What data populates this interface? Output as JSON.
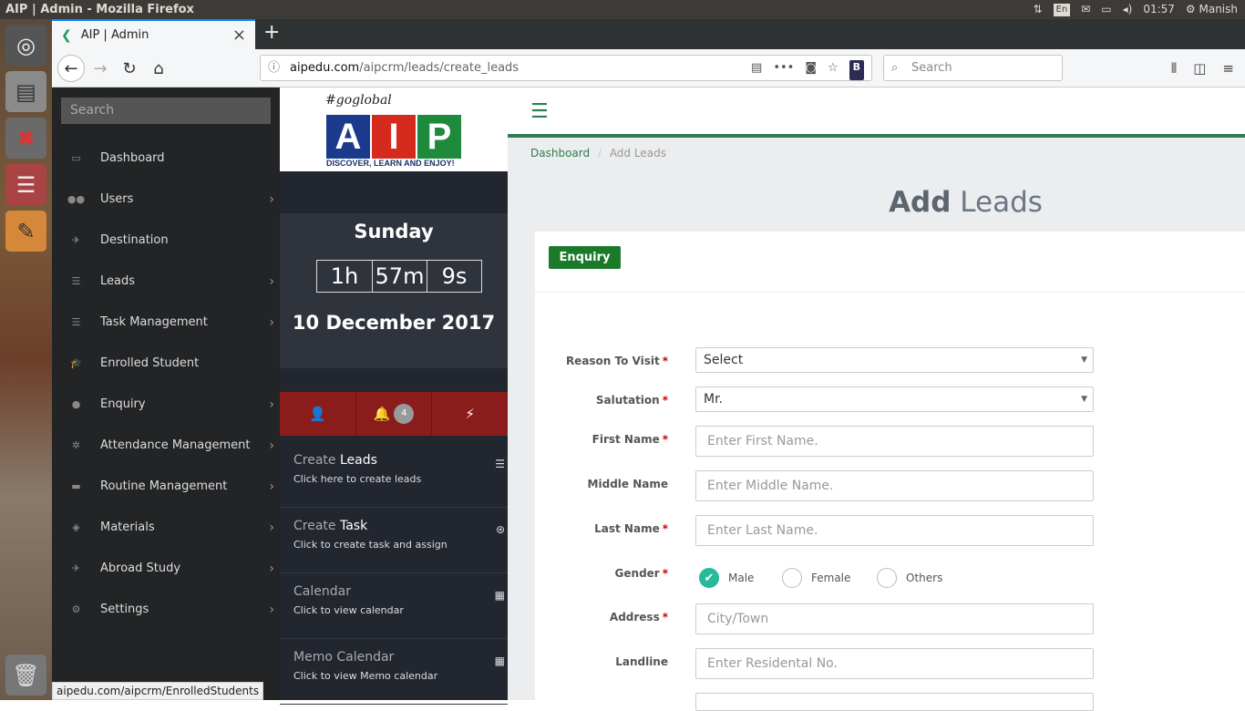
{
  "os": {
    "window_title": "AIP | Admin - Mozilla Firefox",
    "lang": "En",
    "time": "01:57",
    "user": "Manish"
  },
  "browser": {
    "tab_title": "AIP | Admin",
    "url_host": "aipedu.com",
    "url_path": "/aipcrm/leads/create_leads",
    "search_placeholder": "Search",
    "status_url": "aipedu.com/aipcrm/EnrolledStudents"
  },
  "sidebar": {
    "search_placeholder": "Search",
    "items": [
      {
        "label": "Dashboard",
        "icon": "laptop-icon",
        "chev": false
      },
      {
        "label": "Users",
        "icon": "users-icon",
        "chev": true
      },
      {
        "label": "Destination",
        "icon": "plane-icon",
        "chev": false
      },
      {
        "label": "Leads",
        "icon": "list-icon",
        "chev": true
      },
      {
        "label": "Task Management",
        "icon": "tasks-icon",
        "chev": true
      },
      {
        "label": "Enrolled Student",
        "icon": "graduation-icon",
        "chev": false
      },
      {
        "label": "Enquiry",
        "icon": "info-icon",
        "chev": true
      },
      {
        "label": "Attendance Management",
        "icon": "asterisk-icon",
        "chev": true
      },
      {
        "label": "Routine Management",
        "icon": "card-icon",
        "chev": true
      },
      {
        "label": "Materials",
        "icon": "cube-icon",
        "chev": true
      },
      {
        "label": "Abroad Study",
        "icon": "plane-icon",
        "chev": true
      },
      {
        "label": "Settings",
        "icon": "gears-icon",
        "chev": true
      }
    ]
  },
  "brand": {
    "hashtag": "#goglobal",
    "letters": [
      "A",
      "I",
      "P"
    ],
    "tagline": "DISCOVER, LEARN AND ENJOY!"
  },
  "clock": {
    "day": "Sunday",
    "hours": "1h",
    "minutes": "57m",
    "seconds": "9s",
    "date": "10 December 2017"
  },
  "quick": {
    "notif_count": "4",
    "items": [
      {
        "title_a": "Create ",
        "title_b": "Leads",
        "sub": "Click here to create leads"
      },
      {
        "title_a": "Create ",
        "title_b": "Task",
        "sub": "Click to create task and assign"
      },
      {
        "title_a": "Calendar",
        "title_b": "",
        "sub": "Click to view calendar"
      },
      {
        "title_a": "Memo Calendar",
        "title_b": "",
        "sub": "Click to view Memo calendar"
      }
    ]
  },
  "page": {
    "breadcrumb_home": "Dashboard",
    "breadcrumb_sep": "/",
    "breadcrumb_current": "Add Leads",
    "title_bold": "Add",
    "title_rest": " Leads",
    "tab_label": "Enquiry"
  },
  "form": {
    "reason_label": "Reason To Visit",
    "reason_value": "Select",
    "salutation_label": "Salutation",
    "salutation_value": "Mr.",
    "first_label": "First Name",
    "first_ph": "Enter First Name.",
    "middle_label": "Middle Name",
    "middle_ph": "Enter Middle Name.",
    "last_label": "Last Name",
    "last_ph": "Enter Last Name.",
    "gender_label": "Gender",
    "gender_options": [
      "Male",
      "Female",
      "Others"
    ],
    "gender_selected": "Male",
    "address_label": "Address",
    "address_ph": "City/Town",
    "landline_label": "Landline",
    "landline_ph": "Enter Residental No.",
    "req": "*"
  },
  "colors": {
    "accent": "#2e7d4f",
    "enquiry": "#1b7a2a",
    "red": "#8b1c1c",
    "radio_on": "#26b99a",
    "logo_a": "#1b3a8c",
    "logo_i": "#d52b1e",
    "logo_p": "#1e8a3c"
  }
}
